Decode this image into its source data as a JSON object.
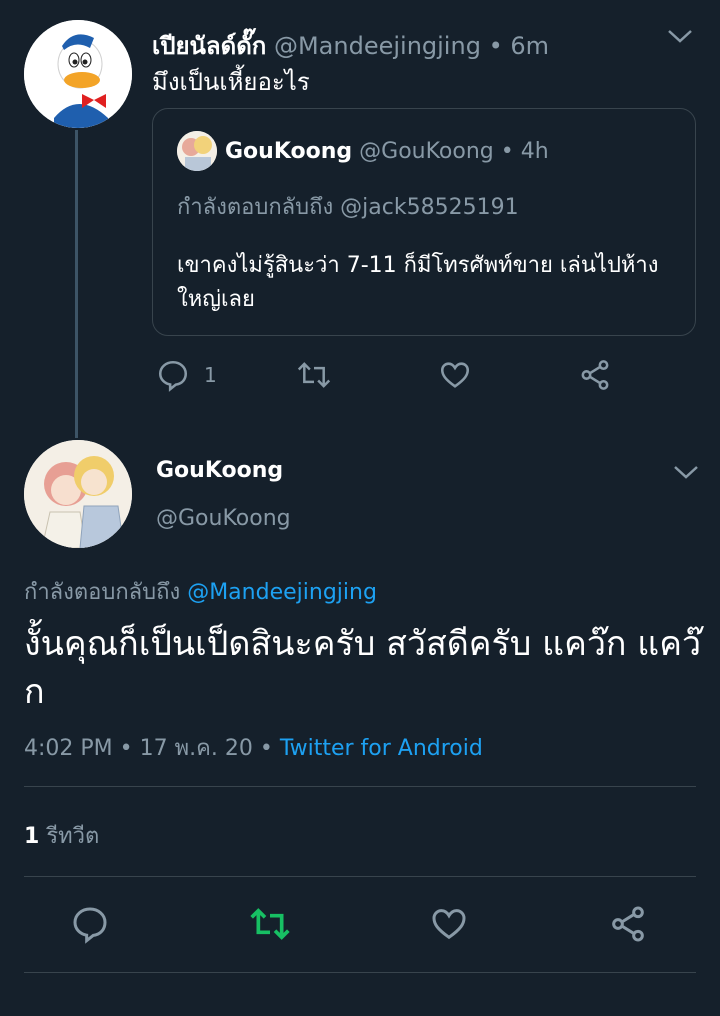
{
  "parent_tweet": {
    "display_name": "เปียนัลด์ดั๊ก",
    "handle": "@Mandeejingjing",
    "separator": "•",
    "time": "6m",
    "text": "มึงเป็นเหี้ยอะไร",
    "reply_count": "1",
    "quoted_tweet": {
      "display_name": "GouKoong",
      "handle": "@GouKoong",
      "separator": "•",
      "time": "4h",
      "replying_to": "กำลังตอบกลับถึง @jack58525191",
      "text": "เขาคงไม่รู้สินะว่า 7-11 ก็มีโทรศัพท์ขาย เล่นไปห้างใหญ่เลย"
    }
  },
  "main_tweet": {
    "display_name": "GouKoong",
    "handle": "@GouKoong",
    "replying_prefix": "กำลังตอบกลับถึง",
    "replying_handle": "@Mandeejingjing",
    "text": "งั้นคุณก็เป็นเป็ดสินะครับ สวัสดีครับ แคว๊ก แคว๊ก",
    "time": "4:02 PM",
    "separator": "•",
    "date": "17 พ.ค. 20",
    "source": "Twitter for Android",
    "retweet_count": "1",
    "retweet_label": "รีทวีต"
  },
  "icons": {
    "reply": "reply-icon",
    "retweet": "retweet-icon",
    "like": "like-icon",
    "share": "share-icon",
    "caret": "chevron-down-icon"
  },
  "colors": {
    "background": "#15202b",
    "muted": "#8899a6",
    "link": "#1da1f2",
    "retweet_active": "#17bf63",
    "border": "#38444d"
  }
}
